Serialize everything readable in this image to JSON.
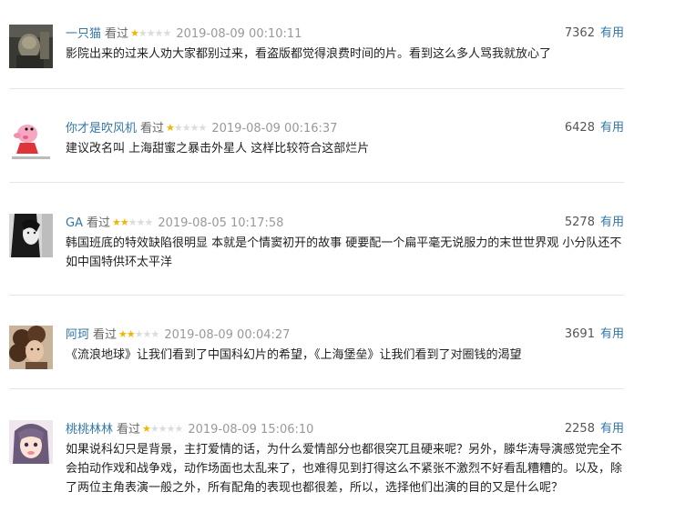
{
  "comments": [
    {
      "user": "一只猫",
      "verb": "看过",
      "stars": 1,
      "time": "2019-08-09 00:10:11",
      "votes": "7362",
      "useful": "有用",
      "text": "影院出来的过来人劝大家都别过来，看盗版都觉得浪费时间的片。看到这么多人骂我就放心了",
      "avatar": "dark-photo-avatar"
    },
    {
      "user": "你才是吹风机",
      "verb": "看过",
      "stars": 1,
      "time": "2019-08-09 00:16:37",
      "votes": "6428",
      "useful": "有用",
      "text": "建议改名叫 上海甜蜜之暴击外星人 这样比较符合这部烂片",
      "avatar": "pink-pig-avatar"
    },
    {
      "user": "GA",
      "verb": "看过",
      "stars": 2,
      "time": "2019-08-05 10:17:58",
      "votes": "5278",
      "useful": "有用",
      "text": "韩国班底的特效缺陷很明显 本就是个情窦初开的故事 硬要配一个扁平毫无说服力的末世世界观 小分队还不如中国特供环太平洋",
      "avatar": "bw-portrait-avatar"
    },
    {
      "user": "阿珂",
      "verb": "看过",
      "stars": 2,
      "time": "2019-08-09 00:04:27",
      "votes": "3691",
      "useful": "有用",
      "text": "《流浪地球》让我们看到了中国科幻片的希望，《上海堡垒》让我们看到了对圈钱的渴望",
      "avatar": "curly-hair-avatar"
    },
    {
      "user": "桃桃林林",
      "verb": "看过",
      "stars": 1,
      "time": "2019-08-09 15:06:10",
      "votes": "2258",
      "useful": "有用",
      "text": "如果说科幻只是背景，主打爱情的话，为什么爱情部分也都很突兀且硬来呢？另外，滕华涛导演感觉完全不会拍动作戏和战争戏，动作场面也太乱来了，也难得见到打得这么不紧张不激烈不好看乱糟糟的。以及，除了两位主角表演一般之外，所有配角的表现也都很差，所以，选择他们出演的目的又是什么呢？",
      "avatar": "anime-girl-avatar"
    }
  ],
  "colors": {
    "link": "#3377aa",
    "star": "#f4b400",
    "star_off": "#dcdcdc",
    "time": "#999999"
  }
}
